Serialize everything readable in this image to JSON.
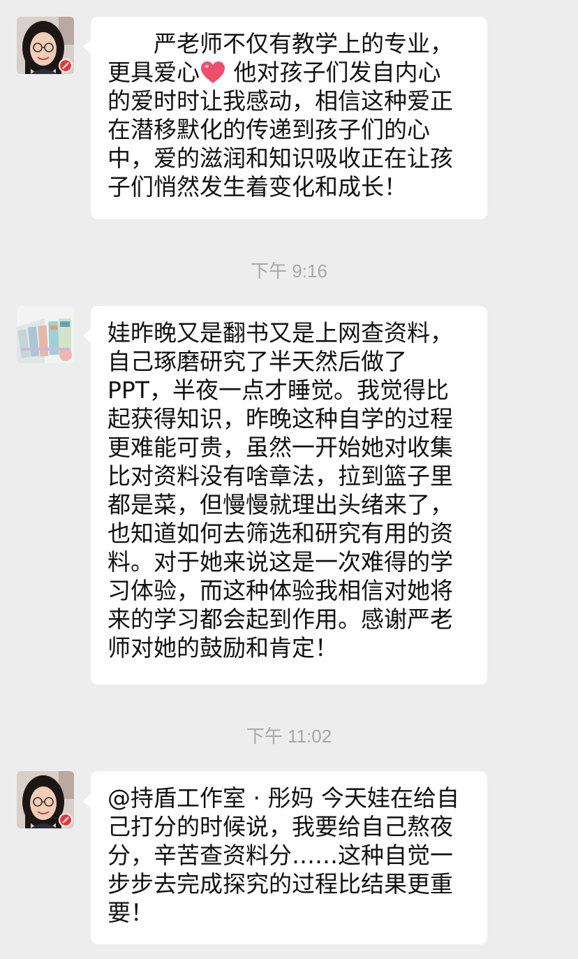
{
  "messages": [
    {
      "avatar": "woman-with-glasses-avatar",
      "lines": [
        "　　严老师不仅有教学上的专业，",
        "更具爱心",
        " 他对孩子们发自内心",
        "的爱时时让我感动，相信这种爱正",
        "在潜移默化的传递到孩子们的心",
        "中，爱的滋润和知识吸收正在让孩",
        "子们悄然发生着变化和成长！"
      ],
      "emoji": "heart-emoji"
    },
    {
      "timestamp": "下午 9:16",
      "avatar": "books-photo-avatar",
      "lines": [
        "娃昨晚又是翻书又是上网查资料，",
        "自己琢磨研究了半天然后做了",
        "PPT，半夜一点才睡觉。我觉得比",
        "起获得知识，昨晚这种自学的过程",
        "更难能可贵，虽然一开始她对收集",
        "比对资料没有啥章法，拉到篮子里",
        "都是菜，但慢慢就理出头绪来了，",
        "也知道如何去筛选和研究有用的资",
        "料。对于她来说这是一次难得的学",
        "习体验，而这种体验我相信对她将",
        "来的学习都会起到作用。感谢严老",
        "师对她的鼓励和肯定！"
      ]
    },
    {
      "timestamp": "下午 11:02",
      "avatar": "woman-with-glasses-avatar",
      "lines": [
        "@持盾工作室 · 彤妈 今天娃在给自",
        "己打分的时候说，我要给自己熬夜",
        "分，辛苦查资料分……这种自觉一",
        "步步去完成探究的过程比结果更重",
        "要！"
      ]
    }
  ],
  "colors": {
    "background": "#ededed",
    "bubble": "#ffffff",
    "text": "#111111",
    "timestamp": "#a8a8a8",
    "heart": "#f04e6e",
    "badge": "#e8383d"
  }
}
